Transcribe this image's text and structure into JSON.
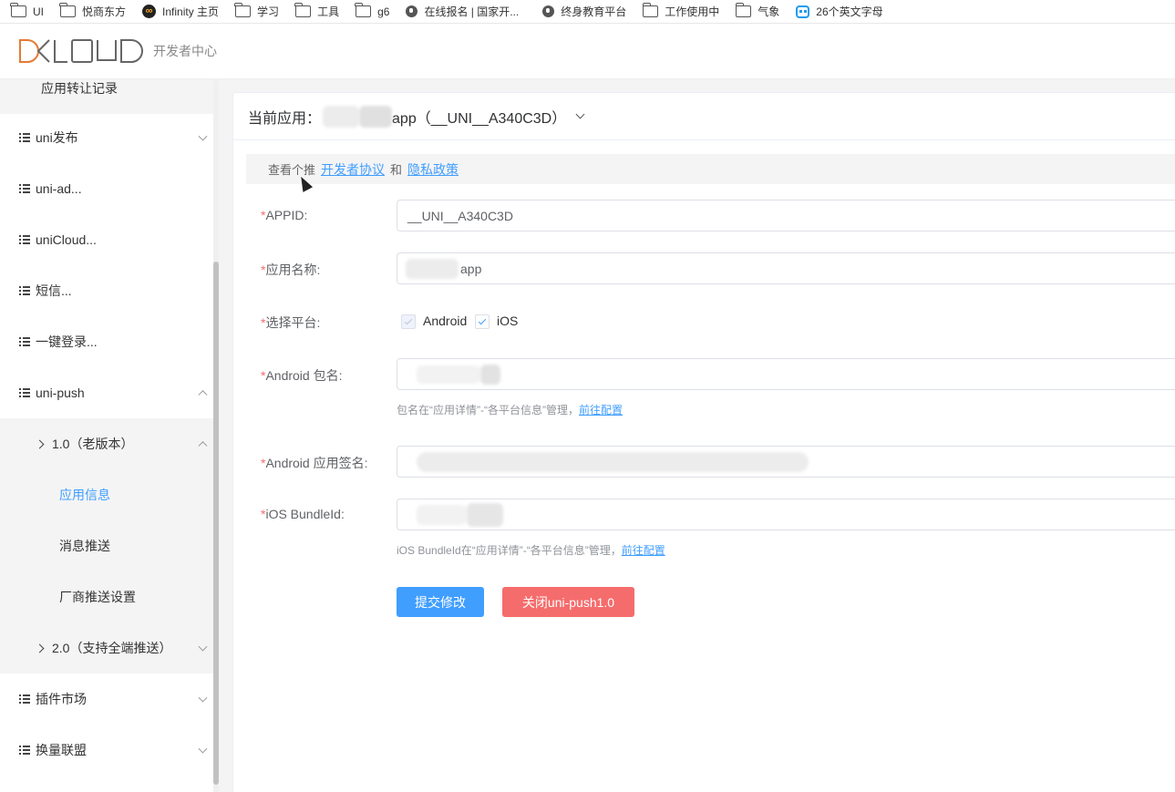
{
  "bookmarks": [
    {
      "icon": "folder-icon",
      "label": "UI"
    },
    {
      "icon": "folder-icon",
      "label": "悦商东方"
    },
    {
      "icon": "infinity-icon",
      "label": "Infinity 主页"
    },
    {
      "icon": "folder-icon",
      "label": "学习"
    },
    {
      "icon": "folder-icon",
      "label": "工具"
    },
    {
      "icon": "folder-icon",
      "label": "g6"
    },
    {
      "icon": "globe-icon",
      "label": "在线报名 | 国家开..."
    },
    {
      "icon": "globe-icon",
      "label": "终身教育平台"
    },
    {
      "icon": "folder-icon",
      "label": "工作使用中"
    },
    {
      "icon": "folder-icon",
      "label": "气象"
    },
    {
      "icon": "robot-icon",
      "label": "26个英文字母"
    }
  ],
  "header": {
    "logo": "DCLOUD",
    "subtitle": "开发者中心"
  },
  "sidebar": {
    "transfer": "应用转让记录",
    "uni_publish": "uni发布",
    "uni_ad": "uni-ad...",
    "unicloud": "uniCloud...",
    "sms": "短信...",
    "one_login": "一键登录...",
    "uni_push": "uni-push",
    "push_v1": "1.0（老版本）",
    "app_info": "应用信息",
    "msg_push": "消息推送",
    "vendor_push": "厂商推送设置",
    "push_v2": "2.0（支持全端推送）",
    "plugin_market": "插件市场",
    "alliance": "换量联盟"
  },
  "card": {
    "current_app_label": "当前应用：",
    "current_app_value": "app（__UNI__A340C3D）"
  },
  "notice": {
    "prefix": "查看个推",
    "link1": "开发者协议",
    "and": "和",
    "link2": "隐私政策"
  },
  "form": {
    "required_mark": "*",
    "appid_label": "APPID:",
    "appid_value": "__UNI__A340C3D",
    "appname_label": "应用名称:",
    "appname_value": "app",
    "platform_label": "选择平台:",
    "platform_android": "Android",
    "platform_ios": "iOS",
    "android_pkg_label": "Android 包名:",
    "android_pkg_hint": "包名在“应用详情”-“各平台信息”管理，",
    "goto_config": "前往配置",
    "android_sign_label": "Android 应用签名:",
    "ios_bundle_label": "iOS BundleId:",
    "ios_bundle_hint": "iOS BundleId在“应用详情”-“各平台信息”管理，"
  },
  "buttons": {
    "submit": "提交修改",
    "close_push": "关闭uni-push1.0"
  },
  "colors": {
    "primary": "#409eff",
    "danger": "#f56c6c",
    "logo_accent": "#e57a35"
  }
}
